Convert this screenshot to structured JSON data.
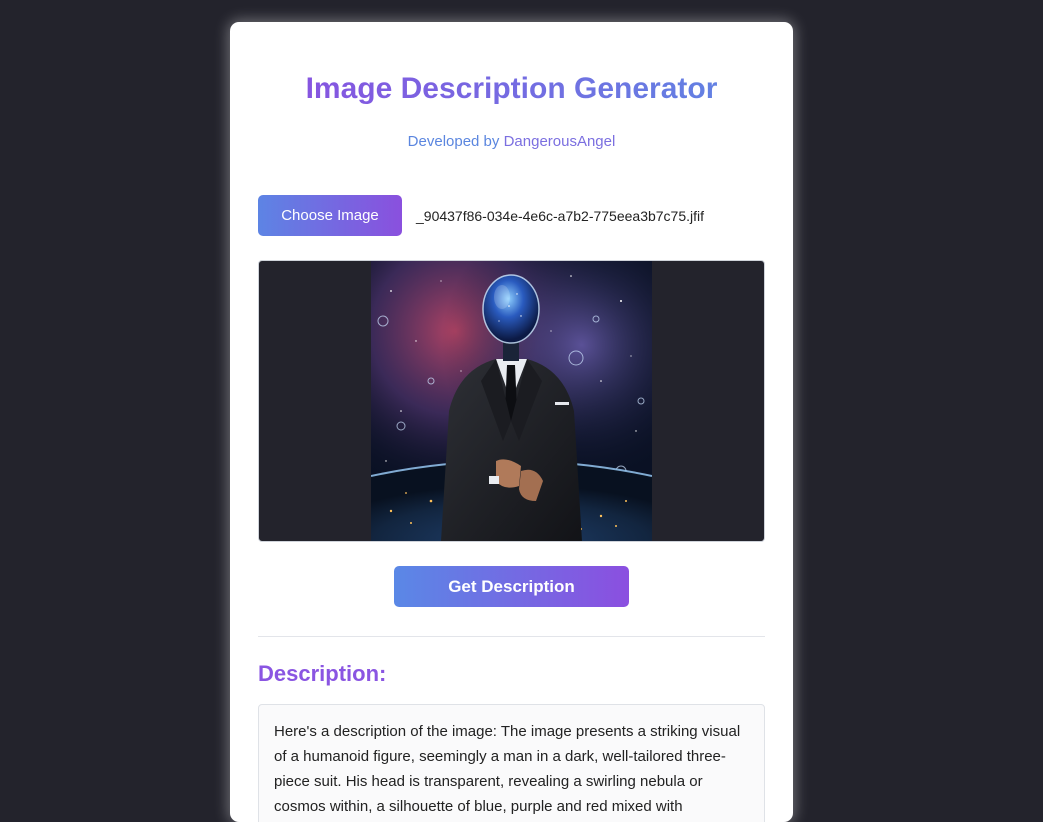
{
  "app": {
    "title": "Image Description Generator",
    "subtitle_prefix": "Developed by ",
    "subtitle_author": "DangerousAngel"
  },
  "upload": {
    "choose_label": "Choose Image",
    "file_name": "_90437f86-034e-4e6c-a7b2-775eea3b7c75.jfif"
  },
  "preview": {
    "image_alt": "Suited figure with transparent helmet head filled with a nebula, floating in space above Earth"
  },
  "actions": {
    "describe_label": "Get Description"
  },
  "result": {
    "heading": "Description:",
    "text": "Here's a description of the image: The image presents a striking visual of a humanoid figure, seemingly a man in a dark, well-tailored three-piece suit. His head is transparent, revealing a swirling nebula or cosmos within, a silhouette of blue, purple and red mixed with"
  },
  "colors": {
    "background": "#23232c",
    "accent_purple": "#8a50e0",
    "accent_blue": "#5d84e4"
  }
}
